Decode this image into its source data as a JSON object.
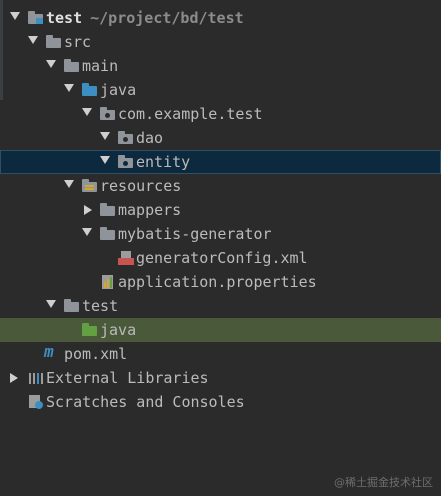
{
  "project_tree": {
    "root": {
      "name": "test",
      "path": "~/project/bd/test"
    },
    "src": "src",
    "main": "main",
    "java_main": "java",
    "package": "com.example.test",
    "dao": "dao",
    "entity": "entity",
    "resources": "resources",
    "mappers": "mappers",
    "mybatis_generator": "mybatis-generator",
    "generator_config": "generatorConfig.xml",
    "app_properties": "application.properties",
    "test": "test",
    "java_test": "java",
    "pom": "pom.xml",
    "external_libraries": "External Libraries",
    "scratches": "Scratches and Consoles"
  },
  "watermark": "@稀土掘金技术社区",
  "colors": {
    "background": "#2b2b2b",
    "selection": "#0d293e",
    "test_highlight": "#49593a",
    "folder_gray": "#8f949b",
    "folder_blue": "#3d8fc2",
    "folder_green": "#62a043"
  }
}
